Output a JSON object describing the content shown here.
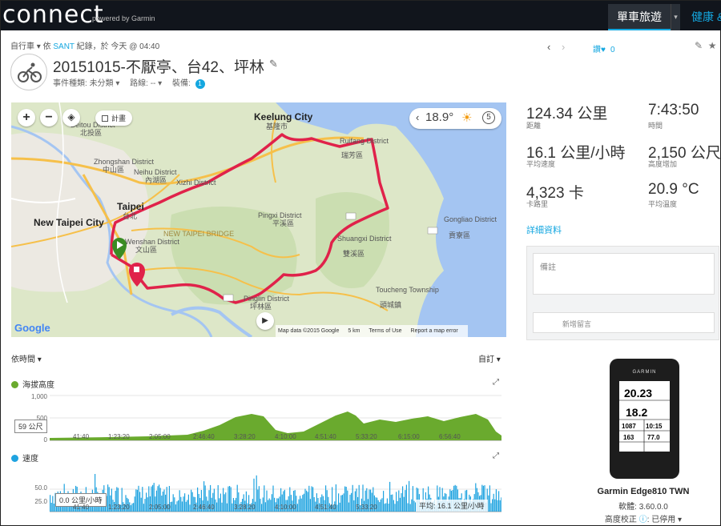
{
  "header": {
    "logo": "connect",
    "powered_by": "powered by Garmin",
    "nav_active": "單車旅遊",
    "nav_next": "健康 &"
  },
  "activity": {
    "crumb_type": "自行車",
    "crumb_by": "依",
    "crumb_user": "SANT",
    "crumb_rest": "紀錄，於 今天 @ 04:40",
    "title": "20151015-不厭亭、台42、坪林",
    "event_type_label": "事件種類:",
    "event_type_value": "未分類",
    "route_label": "路線:",
    "route_value": "--",
    "gear_label": "裝備:",
    "gear_count": "1",
    "like_label": "讚",
    "like_count": "0"
  },
  "map": {
    "zoom_in": "+",
    "zoom_out": "−",
    "plan_label": "計畫",
    "temperature": "18.9°",
    "weather_count": "5",
    "google": "Google",
    "credits": [
      "Map data ©2015 Google",
      "5 km",
      "Terms of Use",
      "Report a map error"
    ],
    "labels": {
      "keelung": "Keelung City",
      "keelung_zh": "基隆市",
      "taipei": "Taipei",
      "taipei_zh": "台北",
      "new_taipei": "New Taipei City",
      "beitou": "Beitou District",
      "beitou_zh": "北投區",
      "neihu": "Neihu District",
      "neihu_zh": "內湖區",
      "xizhi": "Xizhi District",
      "zhongshan": "Zhongshan District",
      "zhongshan_zh": "中山區",
      "wenshan": "Wenshan District",
      "wenshan_zh": "文山區",
      "pingxi": "Pingxi District",
      "pingxi_zh": "平溪區",
      "shuangxi": "Shuangxi District",
      "shuangxi_zh": "雙溪區",
      "ruifang": "Ruifang District",
      "ruifang_zh": "瑞芳區",
      "gongliao": "Gongliao District",
      "gongliao_zh": "貢寮區",
      "toucheng": "Toucheng Township",
      "toucheng_zh": "頭城鎮",
      "pinglin": "Pinglin District",
      "pinglin_zh": "坪林區",
      "new_taipei_bridge": "NEW TAIPEI BRIDGE"
    }
  },
  "stats": [
    {
      "value": "124.34 公里",
      "label": "距離"
    },
    {
      "value": "7:43:50",
      "label": "時間"
    },
    {
      "value": "16.1 公里/小時",
      "label": "平均速度"
    },
    {
      "value": "2,150 公尺",
      "label": "高度增加"
    },
    {
      "value": "4,323 卡",
      "label": "卡路里"
    },
    {
      "value": "20.9 °C",
      "label": "平均溫度"
    }
  ],
  "details_link": "詳細資料",
  "comments": {
    "notes_placeholder": "備註",
    "new_comment_placeholder": "新增留言"
  },
  "device": {
    "brand": "GARMIN",
    "name": "Garmin Edge810 TWN",
    "firmware": "軟體: 3.60.0.0",
    "calibration_label": "高度校正",
    "calibration_value": "已停用",
    "screen": {
      "distance": "20.23",
      "speed": "18.2",
      "elevation": "1087",
      "time": "10:15",
      "hr": "163",
      "temp": "77.0"
    }
  },
  "charts_header": {
    "by_time": "依時間",
    "custom": "自訂"
  },
  "elevation_chart": {
    "title": "海拔高度",
    "y_ticks": [
      "1,000",
      "500",
      "0"
    ],
    "hover": "59 公尺",
    "x_ticks": [
      "41:40",
      "1:23:20",
      "2:05:00",
      "2:46:40",
      "3:28:20",
      "4:10:00",
      "4:51:40",
      "5:33:20",
      "6:15:00",
      "6:56:40"
    ],
    "color": "#6aaa2e"
  },
  "speed_chart": {
    "title": "速度",
    "y_ticks": [
      "50.0",
      "25.0"
    ],
    "hover": "0.0 公里/小時",
    "avg": "平均: 16.1 公里/小時",
    "color": "#1fa3e0"
  },
  "colors": {
    "accent": "#14a7e0",
    "route": "#e0224a",
    "topbar": "#11151c"
  }
}
